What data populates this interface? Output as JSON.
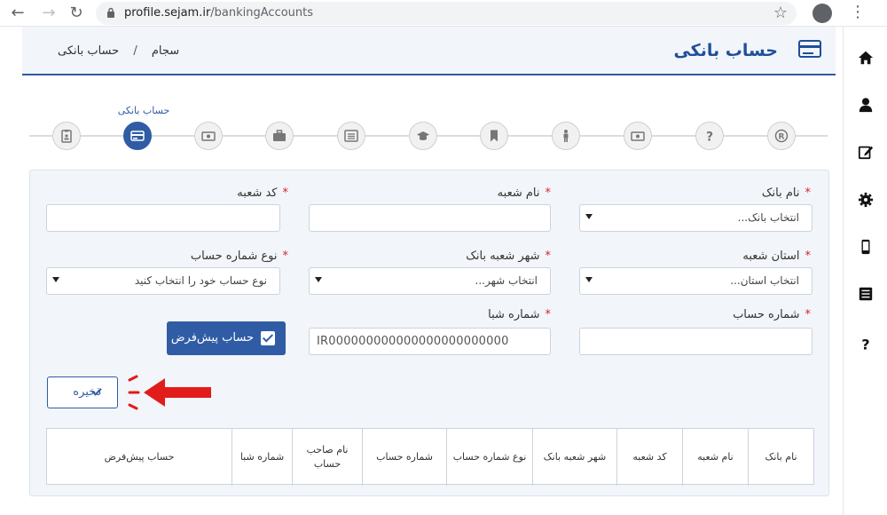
{
  "browser": {
    "url_host": "profile.sejam.ir",
    "url_path": "/bankingAccounts"
  },
  "header": {
    "title": "حساب بانکی",
    "breadcrumb": [
      "سجام",
      "حساب بانکی"
    ]
  },
  "stepper": {
    "active_label": "حساب بانکی",
    "steps": [
      "registration-icon",
      "help-icon",
      "financial-icon",
      "person-icon",
      "bookmark-icon",
      "education-icon",
      "list-icon",
      "briefcase-icon",
      "financial-icon",
      "bank-card-icon",
      "clipboard-icon"
    ]
  },
  "form": {
    "bank_name": {
      "label": "نام بانک",
      "value": "انتخاب بانک..."
    },
    "branch_name": {
      "label": "نام شعبه",
      "value": ""
    },
    "branch_code": {
      "label": "کد شعبه",
      "value": ""
    },
    "branch_province": {
      "label": "استان شعبه",
      "value": "انتخاب استان..."
    },
    "branch_city": {
      "label": "شهر شعبه بانک",
      "value": "انتخاب شهر..."
    },
    "account_type": {
      "label": "نوع شماره حساب",
      "value": "نوع حساب خود را انتخاب کنید"
    },
    "account_number": {
      "label": "شماره حساب",
      "value": ""
    },
    "sheba": {
      "label": "شماره شبا",
      "value": "IR000000000000000000000000"
    },
    "default_account_label": "حساب پیش‌فرض",
    "save_label": "ذخیره"
  },
  "table": {
    "headers": [
      "نام بانک",
      "نام شعبه",
      "کد شعبه",
      "شهر شعبه بانک",
      "نوع شماره حساب",
      "شماره حساب",
      "نام صاحب حساب",
      "شماره شبا",
      "حساب پیش‌فرض"
    ]
  },
  "colors": {
    "primary": "#2f5ca5",
    "required": "#d9232d",
    "arrow": "#e21b1b"
  }
}
